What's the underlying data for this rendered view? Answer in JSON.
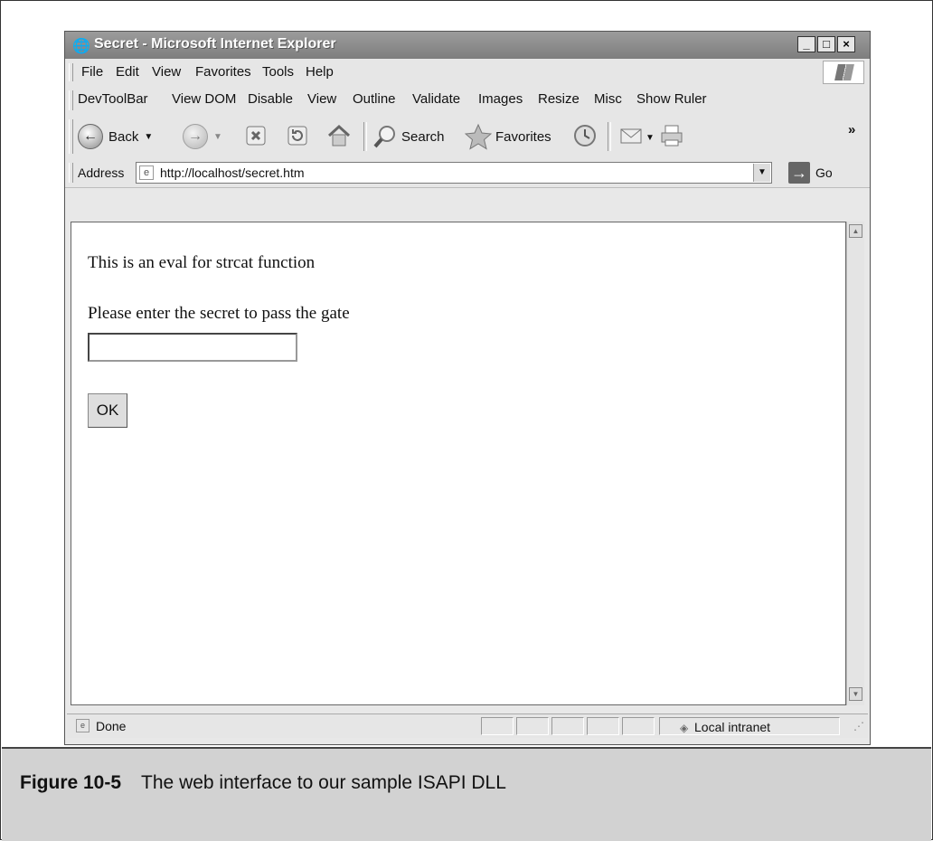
{
  "window": {
    "title": "Secret - Microsoft Internet Explorer",
    "controls": {
      "minimize": "_",
      "maximize": "□",
      "close": "×"
    }
  },
  "menu": {
    "items": [
      "File",
      "Edit",
      "View",
      "Favorites",
      "Tools",
      "Help"
    ]
  },
  "devtoolbar": {
    "items": [
      "DevToolBar",
      "View DOM",
      "Disable",
      "View",
      "Outline",
      "Validate",
      "Images",
      "Resize",
      "Misc",
      "Show Ruler"
    ]
  },
  "toolbar": {
    "back_label": "Back",
    "search_label": "Search",
    "favorites_label": "Favorites",
    "overflow": "»"
  },
  "address": {
    "label": "Address",
    "url": "http://localhost/secret.htm",
    "go_label": "Go"
  },
  "page": {
    "line1": "This is an eval for strcat function",
    "line2": "Please enter the secret to pass the gate",
    "input_value": "",
    "ok_label": "OK"
  },
  "status": {
    "text": "Done",
    "zone": "Local intranet"
  },
  "caption": {
    "number": "Figure 10-5",
    "text": "The web interface to our sample ISAPI DLL"
  },
  "icons": [
    "ie-page-icon",
    "windows-logo-icon",
    "back-arrow-icon",
    "forward-arrow-icon",
    "stop-icon",
    "refresh-icon",
    "home-icon",
    "search-icon",
    "favorites-star-icon",
    "history-icon",
    "mail-icon",
    "print-icon",
    "go-arrow-icon",
    "done-page-icon",
    "intranet-icon"
  ]
}
